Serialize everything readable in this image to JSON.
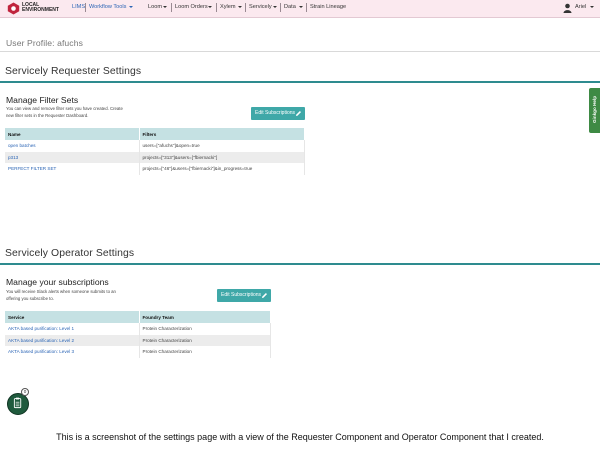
{
  "topbar": {
    "logo_line1": "LOCAL",
    "logo_line2": "ENVIRONMENT",
    "nav": {
      "lims": "LIMS",
      "workflow_tools": "Workflow Tools",
      "loom": "Loom",
      "loom_orders": "Loom Orders",
      "xylem": "Xylem",
      "servicely": "Servicely",
      "data": "Data",
      "strain_lineage": "Strain Lineage"
    },
    "user_name": "Ariel"
  },
  "profile": {
    "title": "User Profile: afuchs"
  },
  "requester": {
    "section_title": "Servicely Requester Settings",
    "subtitle": "Manage Filter Sets",
    "description_line1": "You can view and remove filter sets you have created. Create",
    "description_line2": "new filter sets in the Requester Dashboard.",
    "button_label": "Edit Subscriptions",
    "columns": [
      "Name",
      "Filters"
    ],
    "rows": [
      {
        "name": "open batches",
        "filters": "users=[\"afuchs\"]&open=true"
      },
      {
        "name": "p313",
        "filters": "projects=[\"313\"]&users=[\"fbiernacki\"]"
      },
      {
        "name": "PERFECT FILTER SET",
        "filters": "projects=[\"46\"]&users=[\"fbiernacki\"]&in_progress=true"
      }
    ]
  },
  "operator": {
    "section_title": "Servicely Operator Settings",
    "subtitle": "Manage your subscriptions",
    "description_line1": "You will receive Slack alerts when someone submits to an",
    "description_line2": "offering you subscribe to.",
    "button_label": "Edit Subscriptions",
    "columns": [
      "Service",
      "Foundry Team"
    ],
    "rows": [
      {
        "service": "AKTA based purification: Level 1",
        "team": "Protein Characterization"
      },
      {
        "service": "AKTA based purification: Level 2",
        "team": "Protein Characterization"
      },
      {
        "service": "AKTA based purification: Level 3",
        "team": "Protein Characterization"
      }
    ]
  },
  "side_tab": {
    "label": "Ginkgo Help"
  },
  "fab": {
    "badge": "0"
  },
  "caption": "This is a screenshot of the settings page with a view of the Requester Component and Operator Component that I created.",
  "colors": {
    "topbar_bg": "#fbe9ef",
    "teal_rule": "#2e8b8f",
    "button": "#3fa8a8",
    "table_header": "#c5e1e3",
    "link": "#2a64b5",
    "help_tab": "#3e8a44"
  }
}
